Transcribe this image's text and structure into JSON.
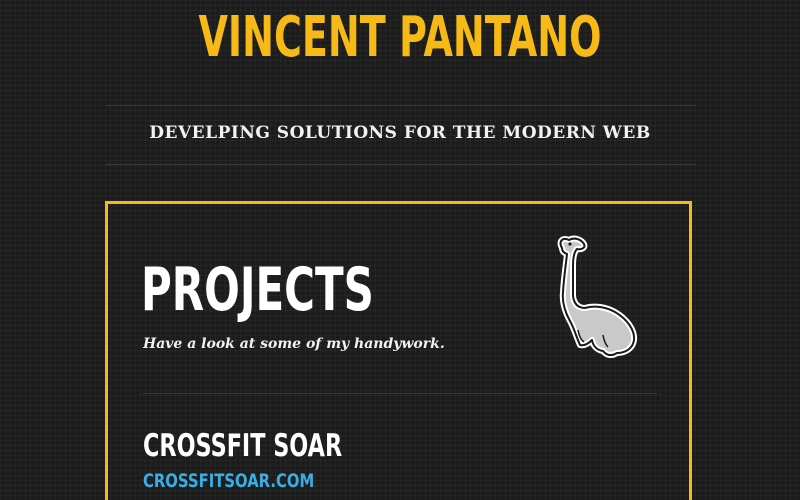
{
  "header": {
    "title": "VINCENT PANTANO",
    "tagline": "DEVELPING SOLUTIONS FOR THE MODERN WEB"
  },
  "projects": {
    "heading": "PROJECTS",
    "subheading": "Have a look at some of my handywork.",
    "mascot_icon": "dinosaur-icon",
    "items": [
      {
        "name": "CROSSFIT SOAR",
        "link": "CROSSFITSOAR.COM"
      }
    ]
  },
  "colors": {
    "background": "#1c1c1c",
    "accent": "#f6b916",
    "link": "#3aaee4",
    "text": "#ffffff"
  }
}
